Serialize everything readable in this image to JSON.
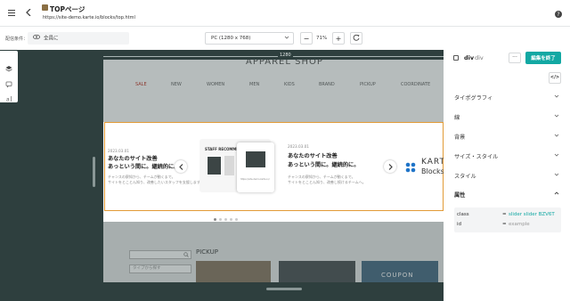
{
  "header": {
    "page_title": "TOPページ",
    "page_url": "https://site-demo.karte.io/blocks/top.html"
  },
  "toolbar": {
    "condition_label": "配信条件：",
    "condition_value": "全員に",
    "device_value": "PC (1280 x 768)",
    "zoom_value": "71%",
    "zoom_minus": "−",
    "zoom_plus": "+"
  },
  "canvas": {
    "ruler_width": "1280"
  },
  "preview": {
    "shop_title": "APPAREL SHOP",
    "nav": [
      "SALE",
      "NEW",
      "WOMEN",
      "MEN",
      "KIDS",
      "BRAND",
      "PICKUP",
      "COORDINATE"
    ],
    "nav_colors": {
      "sale": "#c0392b"
    },
    "slide_left": {
      "date": "2023.03.01",
      "heading_line1": "あなたのサイト改善",
      "heading_line2": "あっという間に。継続的に。",
      "desc_line1": "チャンスの察知から、チームが動くまで。",
      "desc_line2": "サイトをとことん知り、改善したいスタッフを支援します。"
    },
    "slide_center": {
      "staff_label": "STAFF RECOMMEN",
      "phone_url": "https://site-demo.karte.io/"
    },
    "slide_right": {
      "date": "2023.03.01",
      "heading_line1": "あなたのサイト改善",
      "heading_line2": "あっという間に。継続的に。",
      "desc_line1": "チャンスの察知から、チームが動くまで。",
      "desc_line2": "サイトをとことん知り、改善し続けるチームへ。"
    },
    "slide_logo": {
      "line1": "KART",
      "line2": "Blocks"
    },
    "pickup_label": "PICKUP",
    "search_placeholder": "",
    "tag_placeholder": "タイプから探す",
    "coupon_text": "COUPON"
  },
  "panel": {
    "element_tag": "div",
    "element_name": "div",
    "more_label": "···",
    "finish_button": "編集を終了",
    "code_label": "</>",
    "sections": [
      "タイポグラフィ",
      "線",
      "背景",
      "サイズ・スタイル",
      "スタイル"
    ],
    "attributes_title": "属性",
    "attributes": [
      {
        "key": "class",
        "value": "slider slider BZV6T"
      },
      {
        "key": "id",
        "value": "example"
      }
    ],
    "colors": {
      "accent": "#12a8a3",
      "selection": "#e29b37"
    }
  }
}
